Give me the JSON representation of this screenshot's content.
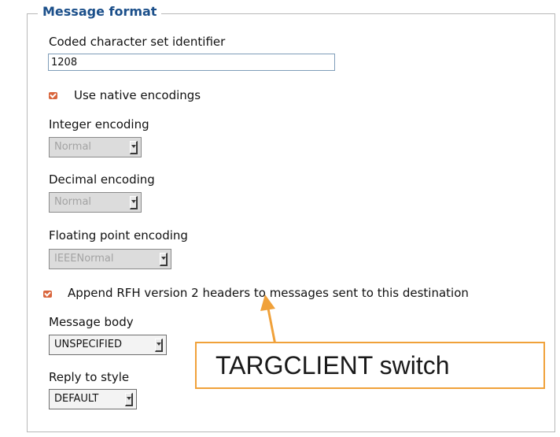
{
  "fieldset": {
    "legend": "Message format"
  },
  "ccsid": {
    "label": "Coded character set identifier",
    "value": "1208"
  },
  "native_encodings": {
    "label": "Use native encodings",
    "checked": true
  },
  "integer_encoding": {
    "label": "Integer encoding",
    "value": "Normal",
    "disabled": true
  },
  "decimal_encoding": {
    "label": "Decimal encoding",
    "value": "Normal",
    "disabled": true
  },
  "floating_point_encoding": {
    "label": "Floating point encoding",
    "value": "IEEENormal",
    "disabled": true
  },
  "append_rfh2": {
    "label": "Append RFH version 2 headers to messages sent to this destination",
    "checked": true
  },
  "message_body": {
    "label": "Message body",
    "value": "UNSPECIFIED"
  },
  "reply_to_style": {
    "label": "Reply to style",
    "value": "DEFAULT"
  },
  "callout": {
    "text": "TARGCLIENT switch"
  },
  "colors": {
    "legend": "#1b4f8a",
    "checkbox": "#d9663d",
    "callout_border": "#f0a13a"
  }
}
